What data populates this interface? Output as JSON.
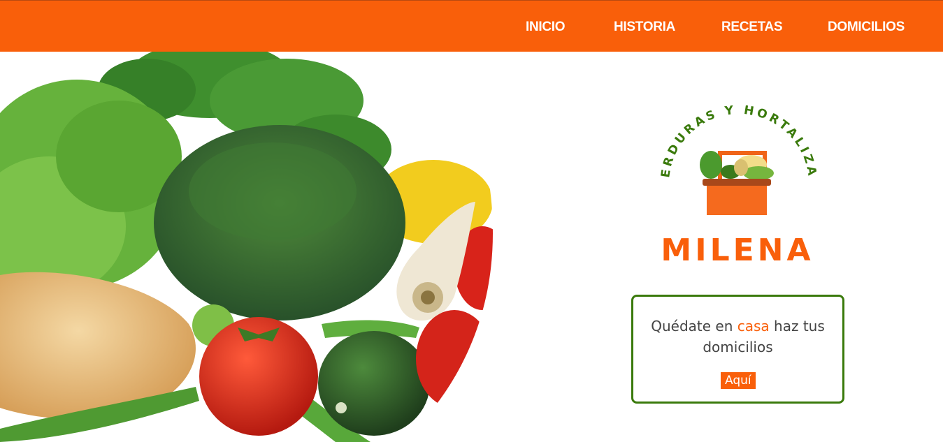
{
  "nav": {
    "items": [
      {
        "label": "INICIO"
      },
      {
        "label": "HISTORIA"
      },
      {
        "label": "RECETAS"
      },
      {
        "label": "DOMICILIOS"
      }
    ]
  },
  "logo": {
    "arc_text": "VERDURAS Y HORTALIZAS",
    "icon": "vegetable-basket-icon"
  },
  "brand": {
    "name": "MILENA"
  },
  "cta": {
    "text_before": "Quédate en ",
    "text_highlight": "casa",
    "text_after": " haz tus domicilios",
    "button_label": "Aquí"
  },
  "colors": {
    "primary": "#f95f0a",
    "accent_green": "#3a7a0c",
    "text": "#444444"
  }
}
